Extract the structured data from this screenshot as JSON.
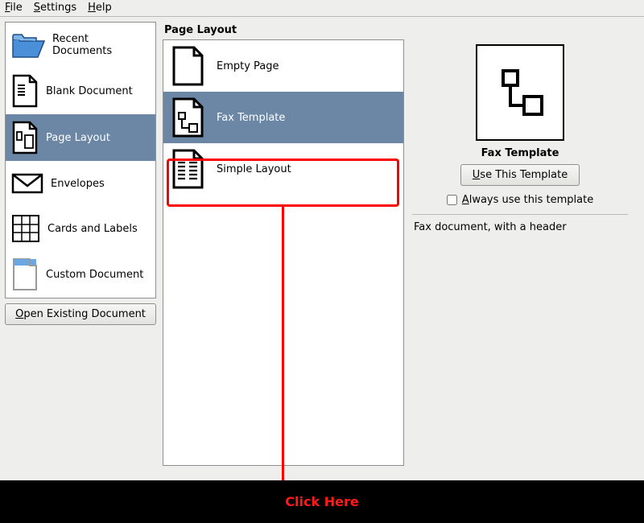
{
  "menu": {
    "file": "File",
    "settings": "Settings",
    "help": "Help"
  },
  "sidebar": {
    "items": [
      {
        "label": "Recent Documents"
      },
      {
        "label": "Blank Document"
      },
      {
        "label": "Page Layout"
      },
      {
        "label": "Envelopes"
      },
      {
        "label": "Cards and Labels"
      },
      {
        "label": "Custom Document"
      }
    ],
    "open_button": "Open Existing Document"
  },
  "section_title": "Page Layout",
  "templates": [
    {
      "label": "Empty Page"
    },
    {
      "label": "Fax Template"
    },
    {
      "label": "Simple Layout"
    }
  ],
  "detail": {
    "title": "Fax Template",
    "use_button": "Use This Template",
    "always_label": "Always use this template",
    "always_checked": false,
    "description": "Fax document, with a header"
  },
  "annotation": {
    "label": "Click Here"
  }
}
